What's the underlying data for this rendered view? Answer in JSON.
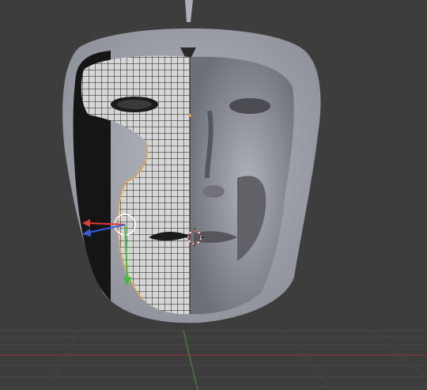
{
  "viewport": {
    "background_color": "#3d3d3d",
    "grid_color": "#4a4a4a",
    "x_axis_color": "#8a3a3a",
    "y_axis_color": "#4f8a3e"
  },
  "model": {
    "shell_color": "#a9abb3",
    "face_color": "#9a9ca4",
    "wire_color": "#1a1a1a",
    "mesh_color": "#d8d8d8",
    "selection_color": "#e8a040"
  },
  "gizmo": {
    "x_arrow_color": "#e03a3a",
    "y_arrow_color": "#3a5ae0",
    "z_arrow_color": "#3ac03a",
    "cursor_color": "#c03030"
  },
  "icons": [
    "3d-cursor-icon",
    "translate-gizmo-icon"
  ]
}
